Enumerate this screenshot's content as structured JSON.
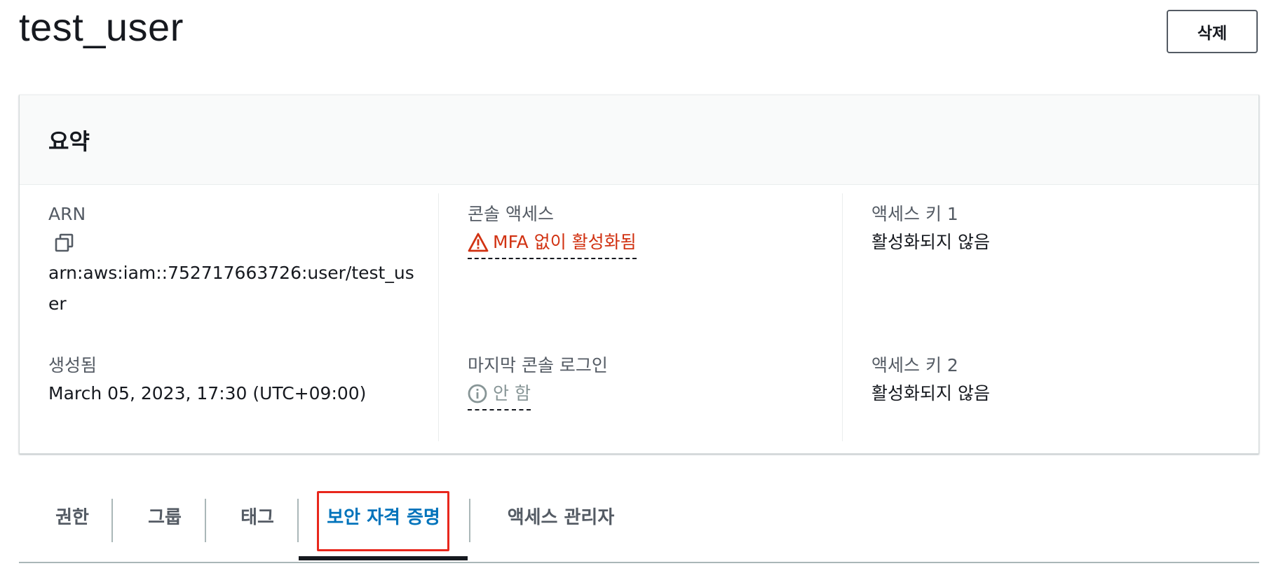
{
  "header": {
    "title": "test_user",
    "delete_label": "삭제"
  },
  "summary": {
    "heading": "요약",
    "arn": {
      "label": "ARN",
      "value": "arn:aws:iam::752717663726:user/test_user",
      "copy_icon": "copy-icon"
    },
    "created": {
      "label": "생성됨",
      "value": "March 05, 2023, 17:30 (UTC+09:00)"
    },
    "console_access": {
      "label": "콘솔 액세스",
      "value": "MFA 없이 활성화됨",
      "icon": "warning-icon",
      "color": "#d13212"
    },
    "last_console_login": {
      "label": "마지막 콘솔 로그인",
      "value": "안 함",
      "icon": "info-icon",
      "color": "#879596"
    },
    "access_key_1": {
      "label": "액세스 키 1",
      "value": "활성화되지 않음"
    },
    "access_key_2": {
      "label": "액세스 키 2",
      "value": "활성화되지 않음"
    }
  },
  "tabs": {
    "items": [
      {
        "label": "권한"
      },
      {
        "label": "그룹"
      },
      {
        "label": "태그"
      },
      {
        "label": "보안 자격 증명",
        "active": true
      },
      {
        "label": "액세스 관리자"
      }
    ],
    "active_color": "#0073bb",
    "highlight_color": "#e8271c"
  }
}
